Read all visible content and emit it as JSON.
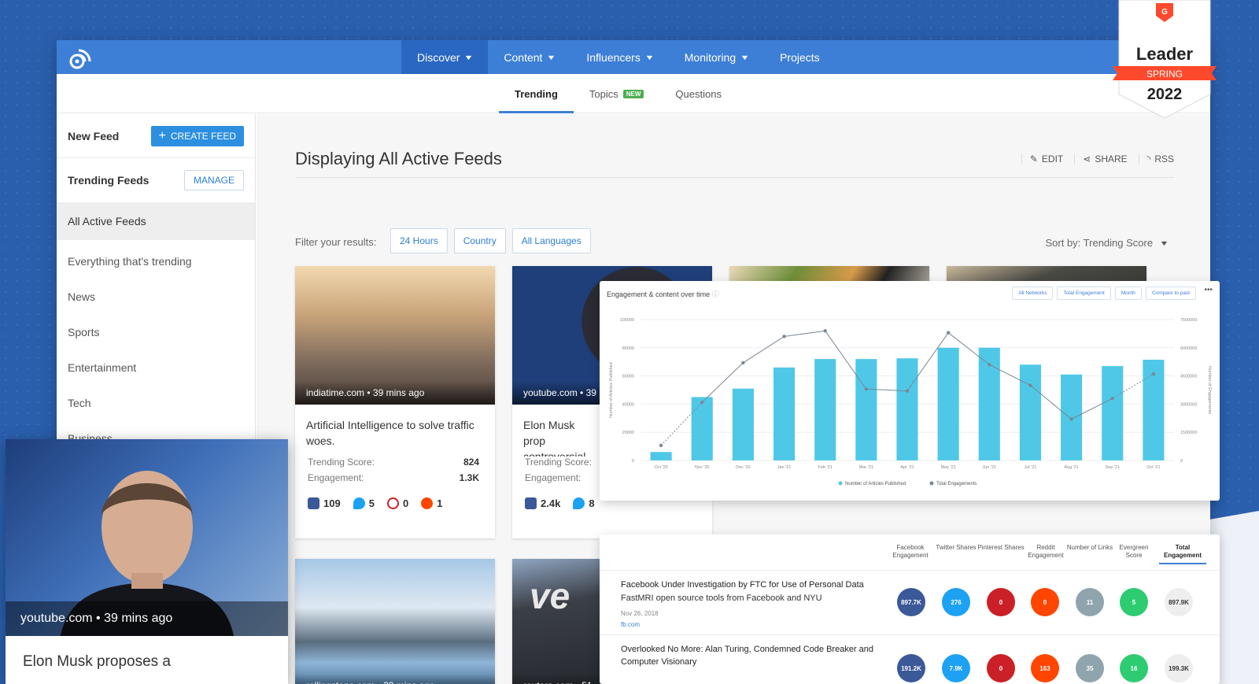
{
  "nav": {
    "items": [
      {
        "label": "Discover",
        "active": true,
        "dropdown": true
      },
      {
        "label": "Content",
        "dropdown": true
      },
      {
        "label": "Influencers",
        "dropdown": true
      },
      {
        "label": "Monitoring",
        "dropdown": true
      },
      {
        "label": "Projects",
        "dropdown": false
      }
    ]
  },
  "subnav": {
    "tabs": [
      {
        "label": "Trending",
        "active": true
      },
      {
        "label": "Topics",
        "badge": "NEW"
      },
      {
        "label": "Questions"
      }
    ]
  },
  "sidebar": {
    "new_feed_label": "New Feed",
    "create_feed_label": "CREATE FEED",
    "trending_feeds_label": "Trending Feeds",
    "manage_label": "MANAGE",
    "items": [
      "All Active Feeds",
      "Everything that's trending",
      "News",
      "Sports",
      "Entertainment",
      "Tech",
      "Business"
    ]
  },
  "main": {
    "title": "Displaying All Active Feeds",
    "actions": {
      "edit": "EDIT",
      "share": "SHARE",
      "rss": "RSS"
    },
    "filter_label": "Filter your results:",
    "filters": [
      "24 Hours",
      "Country",
      "All Languages"
    ],
    "sort_label": "Sort by: Trending Score"
  },
  "cards": [
    {
      "source": "indiatime.com • 39 mins ago",
      "title": "Artificial Intelligence to solve traffic woes.",
      "trending_label": "Trending Score:",
      "trending_value": "824",
      "engagement_label": "Engagement:",
      "engagement_value": "1.3K",
      "facebook": "109",
      "twitter": "5",
      "pinterest": "0",
      "reddit": "1"
    },
    {
      "source": "youtube.com • 39",
      "title": "Elon Musk prop controversial pl spaceflight to M",
      "trending_label": "Trending Score:",
      "engagement_label": "Engagement:",
      "facebook": "2.4k",
      "twitter": "8"
    },
    {
      "source": "rollingstone.com • 39 mins ago"
    },
    {
      "source": "reuters.com • 51"
    }
  ],
  "chart_panel": {
    "title": "Engagement & content over time",
    "buttons": [
      "All Networks",
      "Total Engagement",
      "Month",
      "Compare to past"
    ],
    "more": "•••"
  },
  "chart_data": {
    "type": "bar",
    "categories": [
      "Oct '20",
      "Nov '20",
      "Dec '20",
      "Jan '21",
      "Feb '21",
      "Mar '21",
      "Apr '21",
      "May '21",
      "Jun '21",
      "Jul '21",
      "Aug '21",
      "Sep '21",
      "Oct '21"
    ],
    "series": [
      {
        "name": "Number of Articles Published",
        "type": "bar",
        "axis": "left",
        "color": "#4fc8e8",
        "values": [
          6000,
          45000,
          51000,
          66000,
          72000,
          72000,
          72500,
          80000,
          80000,
          68000,
          61000,
          67000,
          71500
        ]
      },
      {
        "name": "Total Engagements",
        "type": "line",
        "axis": "right",
        "color": "#7b8794",
        "values": [
          800000,
          3100000,
          5200000,
          6600000,
          6900000,
          3800000,
          3700000,
          6800000,
          5100000,
          4000000,
          2200000,
          3300000,
          4600000
        ]
      }
    ],
    "ylabel": "Number of Articles Published",
    "y2label": "Number of Engagements",
    "yticks": [
      "0",
      "20000",
      "40000",
      "60000",
      "80000",
      "100000"
    ],
    "y2ticks": [
      "0",
      "1500000",
      "3000000",
      "4500000",
      "6000000",
      "7500000"
    ],
    "ylim": [
      0,
      100000
    ],
    "y2lim": [
      0,
      7500000
    ],
    "legend": "bottom"
  },
  "table_panel": {
    "headers": [
      "Facebook Engagement",
      "Twitter Shares",
      "Pinterest Shares",
      "Reddit Engagement",
      "Number of Links",
      "Evergreen Score",
      "Total Engagement"
    ],
    "rows": [
      {
        "title": "Facebook Under Investigation by FTC for Use of Personal Data",
        "subtitle": "FastMRI open source tools from Facebook and NYU",
        "date": "Nov 26, 2018",
        "link": "fb.com",
        "values": [
          "897.7K",
          "276",
          "0",
          "0",
          "11",
          "5",
          "897.9K"
        ]
      },
      {
        "title": "Overlooked No More: Alan Turing, Condemned Code Breaker and Computer Visionary",
        "values": [
          "191.2K",
          "7.9K",
          "0",
          "163",
          "35",
          "16",
          "199.3K"
        ]
      }
    ]
  },
  "elon_card": {
    "source": "youtube.com • 39 mins ago",
    "title": "Elon Musk proposes a"
  },
  "badge": {
    "line1": "Leader",
    "line2": "SPRING",
    "line3": "2022"
  },
  "colors": {
    "brand": "#3d7fd6",
    "background": "#2a5fae",
    "bar": "#4fc8e8",
    "facebook": "#3b5998",
    "twitter": "#1da1f2",
    "pinterest": "#cb2027",
    "reddit": "#ff4500"
  }
}
